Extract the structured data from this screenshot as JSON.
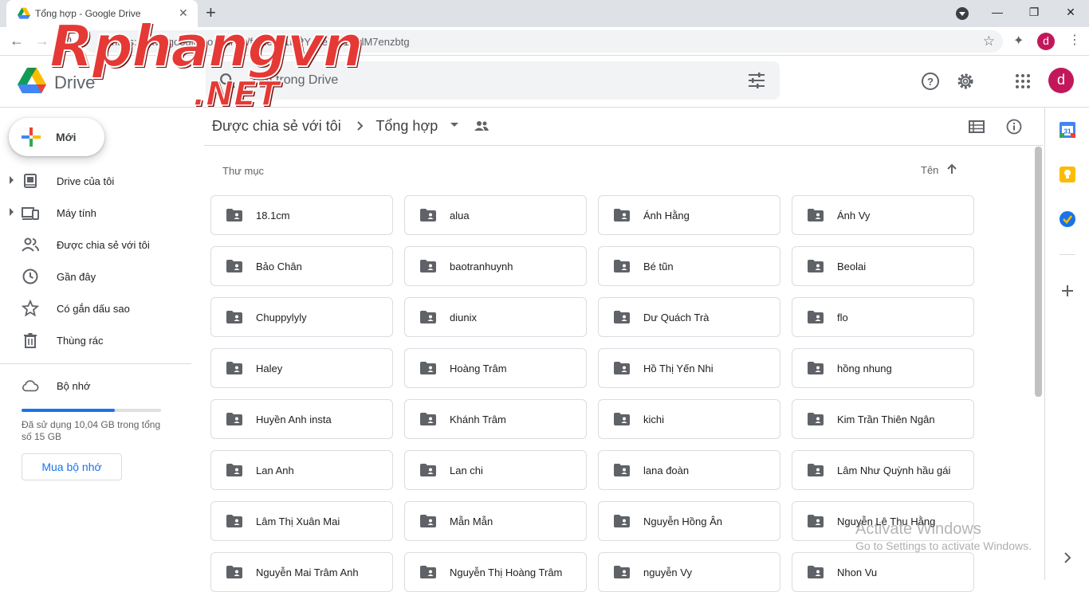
{
  "browser": {
    "tab_title": "Tổng hợp - Google Drive",
    "url": "https://drive.google.com/drive/folders/1DPYs0eRO1xwlM7enzbtg",
    "profile_initial": "d"
  },
  "watermark": {
    "site": "Rphangvn",
    "tld": ".NET"
  },
  "drive": {
    "app_name": "Drive",
    "search_placeholder": "Tìm trong Drive",
    "avatar_initial": "d"
  },
  "sidebar": {
    "new_label": "Mới",
    "items": [
      {
        "label": "Drive của tôi",
        "icon": "my-drive-icon",
        "expandable": true
      },
      {
        "label": "Máy tính",
        "icon": "computers-icon",
        "expandable": true
      },
      {
        "label": "Được chia sẻ với tôi",
        "icon": "shared-icon",
        "expandable": false
      },
      {
        "label": "Gần đây",
        "icon": "clock-icon",
        "expandable": false
      },
      {
        "label": "Có gắn dấu sao",
        "icon": "star-icon",
        "expandable": false
      },
      {
        "label": "Thùng rác",
        "icon": "trash-icon",
        "expandable": false
      }
    ],
    "storage": {
      "label": "Bộ nhớ",
      "usage_text": "Đã sử dụng 10,04 GB trong tổng số 15 GB",
      "used_fraction": 0.67,
      "buy_label": "Mua bộ nhớ"
    }
  },
  "main": {
    "breadcrumb": {
      "parent": "Được chia sẻ với tôi",
      "current": "Tổng hợp"
    },
    "section_title": "Thư mục",
    "sort_label": "Tên",
    "folders": [
      "18.1cm",
      "alua",
      "Ánh Hằng",
      "Ánh Vy",
      "Bảo Chân",
      "baotranhuynh",
      "Bé tũn",
      "Beolai",
      "Chuppylyly",
      "diunix",
      "Dư Quách Trà",
      "flo",
      "Haley",
      "Hoàng Trâm",
      "Hồ Thị Yến Nhi",
      "hồng nhung",
      "Huyền Anh insta",
      "Khánh Trâm",
      "kichi",
      "Kim Trần Thiên Ngân",
      "Lan Anh",
      "Lan chi",
      "lana đoàn",
      "Lâm Như Quỳnh hầu gái",
      "Lâm Thị Xuân Mai",
      "Mẫn Mẫn",
      "Nguyễn Hồng Ân",
      "Nguyễn Lê Thu Hằng",
      "Nguyễn Mai Trâm Anh",
      "Nguyễn Thị Hoàng Trâm",
      "nguyễn Vy",
      "Nhon Vu"
    ]
  },
  "windows_activation": {
    "title": "Activate Windows",
    "subtitle": "Go to Settings to activate Windows."
  },
  "colors": {
    "accent": "#1a73e8",
    "avatar": "#c2185b",
    "folder_icon": "#5f6368"
  }
}
